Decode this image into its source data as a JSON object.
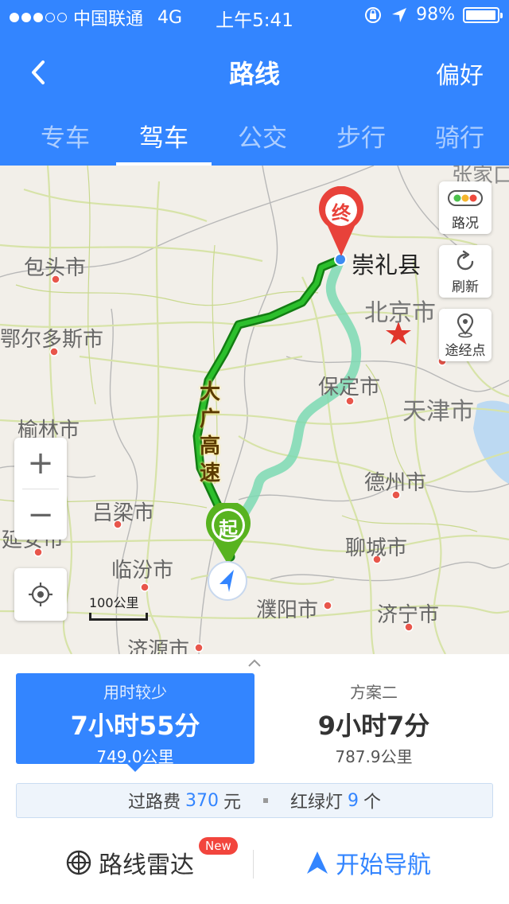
{
  "status_bar": {
    "carrier": "中国联通",
    "network": "4G",
    "time": "上午5:41",
    "battery": "98%",
    "battery_level": 0.98,
    "signal_bars": 3
  },
  "nav": {
    "title": "路线",
    "right_action": "偏好"
  },
  "tabs": [
    {
      "label": "专车",
      "active": false
    },
    {
      "label": "驾车",
      "active": true
    },
    {
      "label": "公交",
      "active": false
    },
    {
      "label": "步行",
      "active": false
    },
    {
      "label": "骑行",
      "active": false
    }
  ],
  "map": {
    "cities": {
      "baotou": "包头市",
      "ordos": "鄂尔多斯市",
      "yulin": "榆林市",
      "lvliang": "吕梁市",
      "yanan": "延安市",
      "linfen": "临汾市",
      "jiyuan": "济源市",
      "beijing": "北京市",
      "tianjin": "天津市",
      "baoding": "保定市",
      "dezhou": "德州市",
      "liaocheng": "聊城市",
      "puyang": "濮阳市",
      "jining": "济宁市",
      "zhangjiakou": "张家口市"
    },
    "destination": "崇礼县",
    "start_marker": "起",
    "end_marker": "终",
    "highway_label": "大广高速",
    "controls": {
      "traffic": "路况",
      "refresh": "刷新",
      "waypoint": "途经点",
      "zoom_in": "+",
      "zoom_out": "−"
    },
    "scale": "100公里"
  },
  "plans": [
    {
      "tag": "用时较少",
      "time": "7小时55分",
      "distance": "749.0公里",
      "selected": true
    },
    {
      "tag": "方案二",
      "time": "9小时7分",
      "distance": "787.9公里",
      "selected": false
    }
  ],
  "info": {
    "toll_label": "过路费",
    "toll_value": "370",
    "toll_unit": "元",
    "lights_label": "红绿灯",
    "lights_value": "9",
    "lights_unit": "个"
  },
  "actions": {
    "radar": "路线雷达",
    "new_badge": "New",
    "navigate": "开始导航"
  },
  "colors": {
    "accent": "#3385ff",
    "route_main": "#1fa81f",
    "route_alt": "#7dd9b3",
    "marker_end": "#e8423a",
    "marker_start": "#58b320"
  }
}
